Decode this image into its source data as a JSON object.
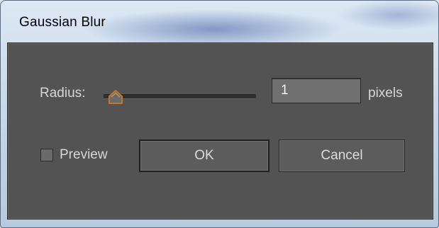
{
  "window": {
    "title": "Gaussian Blur"
  },
  "radius": {
    "label": "Radius:",
    "value": "1",
    "unit": "pixels",
    "slider_level": 0.02
  },
  "preview": {
    "label": "Preview",
    "checked": false
  },
  "buttons": {
    "ok_label": "OK",
    "cancel_label": "Cancel"
  },
  "colors": {
    "dialog_background": "#535353",
    "text": "#d6d6d6",
    "slider_thumb": "#c8742a"
  }
}
